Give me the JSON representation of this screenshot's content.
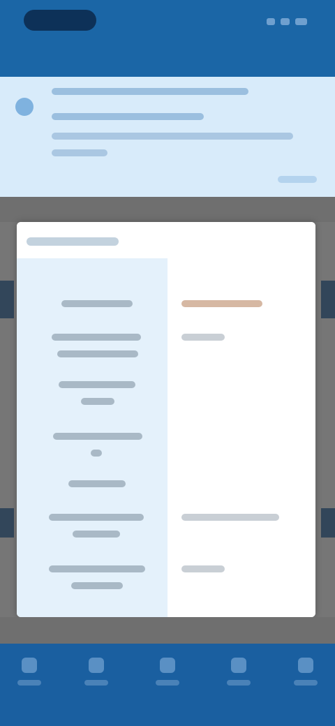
{
  "theme": {
    "primary": "#1b66a6",
    "banner_bg": "#d8ebfa",
    "card_label_bg": "#e4f1fb",
    "overlay": "#767676",
    "accent_value": "#d6b8a3"
  },
  "status_bar": {
    "icons": [
      "signal-icon",
      "wifi-icon",
      "battery-icon"
    ]
  },
  "banner": {
    "icon": "info-icon"
  },
  "detail_card": {
    "row_count": 7
  },
  "bottom_nav": {
    "items": [
      "nav-item-1",
      "nav-item-2",
      "nav-item-3",
      "nav-item-4",
      "nav-item-5"
    ]
  }
}
